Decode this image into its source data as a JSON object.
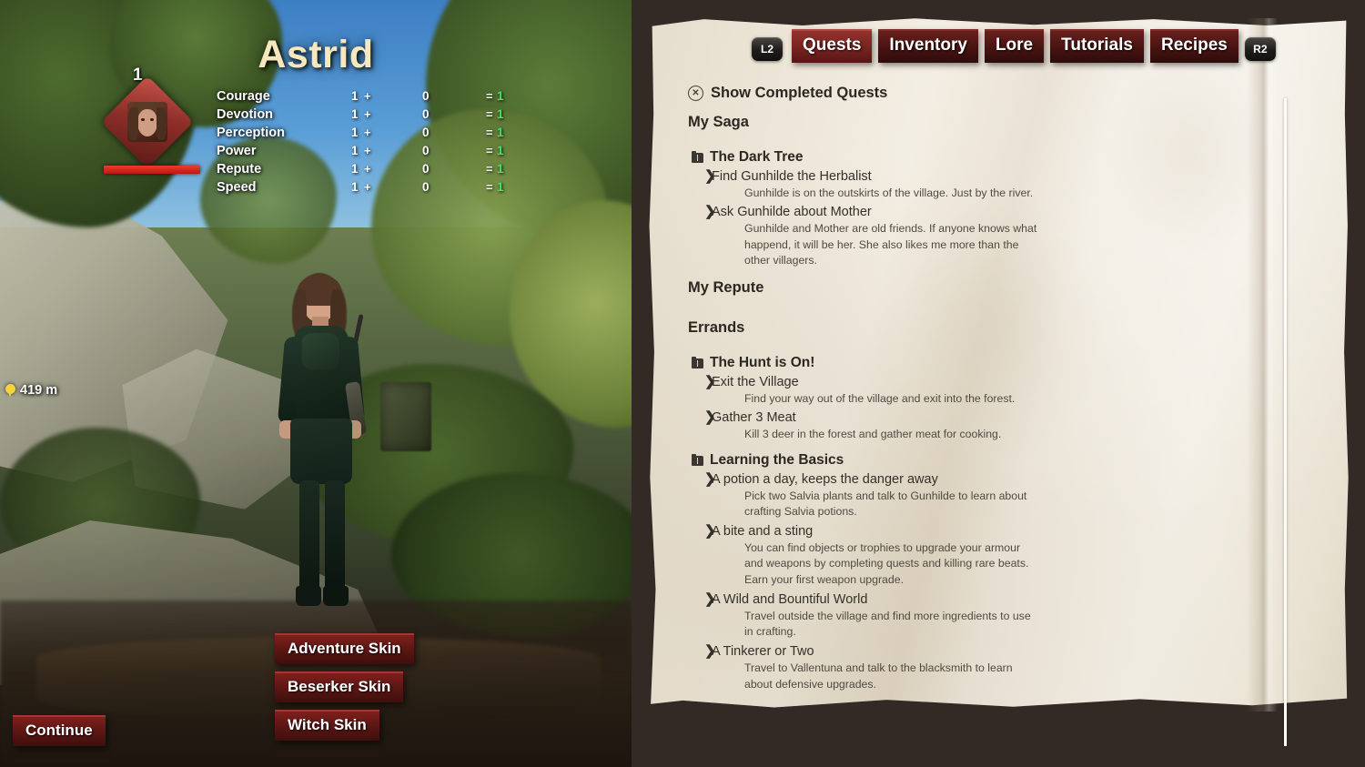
{
  "game": {
    "character_name": "Astrid",
    "level": "1",
    "distance_marker": "419 m",
    "stats": [
      {
        "name": "Courage",
        "base": "1",
        "plus": "+",
        "bonus": "0",
        "eq": "=",
        "total": "1"
      },
      {
        "name": "Devotion",
        "base": "1",
        "plus": "+",
        "bonus": "0",
        "eq": "=",
        "total": "1"
      },
      {
        "name": "Perception",
        "base": "1",
        "plus": "+",
        "bonus": "0",
        "eq": "=",
        "total": "1"
      },
      {
        "name": "Power",
        "base": "1",
        "plus": "+",
        "bonus": "0",
        "eq": "=",
        "total": "1"
      },
      {
        "name": "Repute",
        "base": "1",
        "plus": "+",
        "bonus": "0",
        "eq": "=",
        "total": "1"
      },
      {
        "name": "Speed",
        "base": "1",
        "plus": "+",
        "bonus": "0",
        "eq": "=",
        "total": "1"
      }
    ],
    "buttons": {
      "adventure_skin": "Adventure Skin",
      "beserker_skin": "Beserker Skin",
      "witch_skin": "Witch Skin",
      "continue": "Continue"
    }
  },
  "journal": {
    "left_trigger": "L2",
    "right_trigger": "R2",
    "tabs": [
      {
        "label": "Quests",
        "active": true
      },
      {
        "label": "Inventory",
        "active": false
      },
      {
        "label": "Lore",
        "active": false
      },
      {
        "label": "Tutorials",
        "active": false
      },
      {
        "label": "Recipes",
        "active": false
      }
    ],
    "show_completed": {
      "button_glyph": "✕",
      "label": "Show Completed Quests"
    },
    "sections": [
      {
        "title": "My Saga"
      },
      {
        "title": "My Repute"
      },
      {
        "title": "Errands"
      }
    ],
    "saga_quests": [
      {
        "title": "The Dark Tree",
        "objectives": [
          {
            "chevron": "❯",
            "name": "Find Gunhilde the Herbalist",
            "desc": "Gunhilde is on the outskirts of the village. Just by the river."
          },
          {
            "chevron": "❯",
            "name": "Ask Gunhilde about Mother",
            "desc": "Gunhilde and Mother are old friends. If anyone knows what happend, it will be her. She also likes me more than the other villagers."
          }
        ]
      }
    ],
    "errand_quests": [
      {
        "title": "The Hunt is On!",
        "objectives": [
          {
            "chevron": "❯",
            "name": "Exit the Village",
            "desc": "Find your way out of the village and exit into the forest."
          },
          {
            "chevron": "❯",
            "name": "Gather 3 Meat",
            "desc": "Kill 3 deer in the forest and gather meat for cooking."
          }
        ]
      },
      {
        "title": "Learning the Basics",
        "objectives": [
          {
            "chevron": "❯",
            "name": "A potion a day, keeps the danger away",
            "desc": "Pick two Salvia plants and talk to Gunhilde to learn about crafting Salvia potions."
          },
          {
            "chevron": "❯",
            "name": "A bite and a sting",
            "desc": "You can find objects or trophies to upgrade your armour and weapons by completing quests and killing rare beats. Earn your first weapon upgrade."
          },
          {
            "chevron": "❯",
            "name": "A Wild and Bountiful World",
            "desc": "Travel outside the village and find more ingredients to use in crafting."
          },
          {
            "chevron": "❯",
            "name": "A Tinkerer or Two",
            "desc": "Travel to Vallentuna and talk to the blacksmith to learn about defensive upgrades."
          }
        ]
      }
    ]
  },
  "colors": {
    "tab_active": "#93332d",
    "tab_inactive": "#4a1412",
    "parchment": "#efe9dd",
    "backdrop": "#332a26",
    "stat_total": "#4ddc6a",
    "name_gold": "#f6e7bd",
    "health": "#ef3b2c"
  }
}
